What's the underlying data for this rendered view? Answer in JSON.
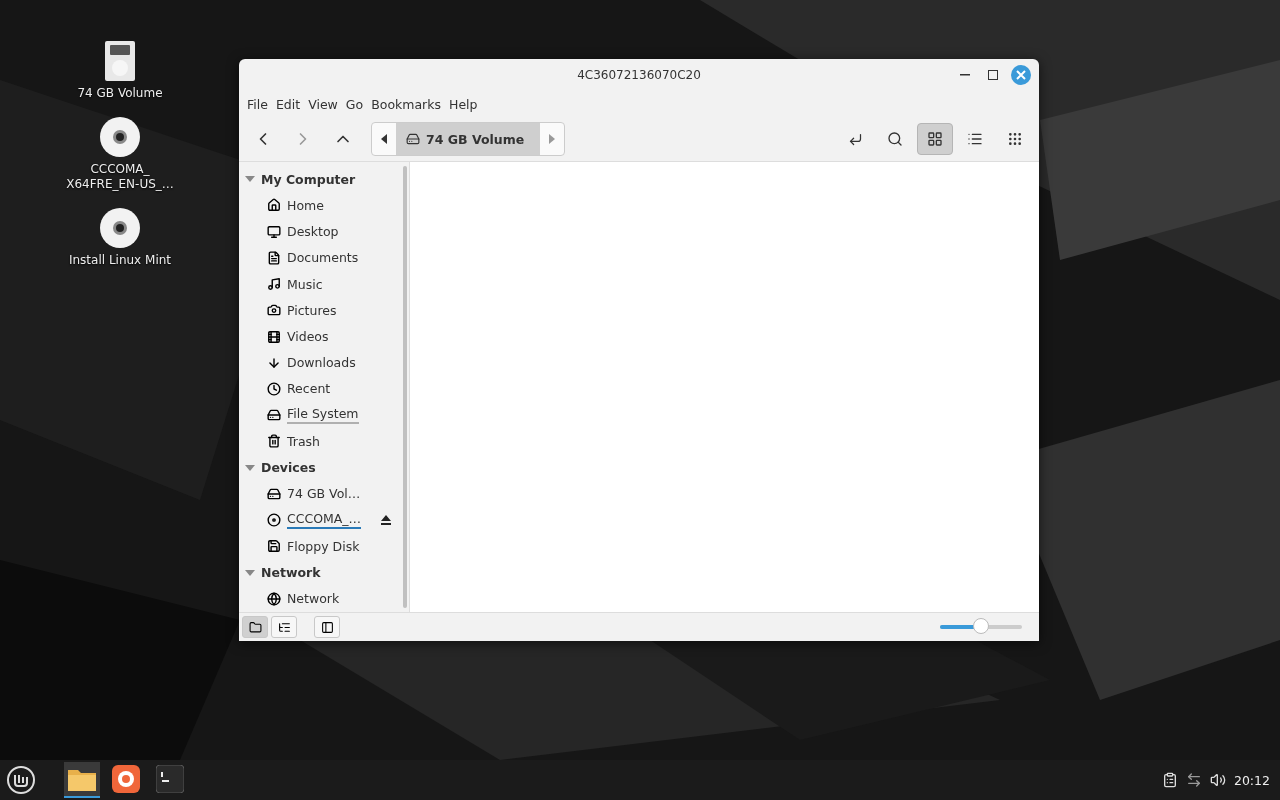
{
  "desktop_icons": [
    {
      "label": "74 GB Volume",
      "kind": "drive"
    },
    {
      "label": "CCCOMA_\nX64FRE_EN-US_…",
      "kind": "disc"
    },
    {
      "label": "Install Linux Mint",
      "kind": "disc"
    }
  ],
  "window": {
    "title": "4C36072136070C20",
    "menu": [
      "File",
      "Edit",
      "View",
      "Go",
      "Bookmarks",
      "Help"
    ],
    "path": {
      "label": "74 GB Volume"
    },
    "views": [
      {
        "kind": "icons",
        "selected": true
      },
      {
        "kind": "list",
        "selected": false
      },
      {
        "kind": "compact",
        "selected": false
      }
    ],
    "sidebar": [
      {
        "label": "My Computer",
        "expanded": true,
        "children": [
          {
            "label": "Home"
          },
          {
            "label": "Desktop"
          },
          {
            "label": "Documents"
          },
          {
            "label": "Music"
          },
          {
            "label": "Pictures"
          },
          {
            "label": "Videos"
          },
          {
            "label": "Downloads"
          },
          {
            "label": "Recent"
          },
          {
            "label": "File System",
            "level": 0
          },
          {
            "label": "Trash"
          }
        ]
      },
      {
        "label": "Devices",
        "expanded": true,
        "children": [
          {
            "label": "74 GB Vol…"
          },
          {
            "label": "CCCOMA_…",
            "level": 1,
            "ejectable": true
          },
          {
            "label": "Floppy Disk"
          }
        ]
      },
      {
        "label": "Network",
        "expanded": true,
        "children": [
          {
            "label": "Network"
          }
        ]
      }
    ],
    "pane_modes": [
      {
        "kind": "places",
        "selected": true
      },
      {
        "kind": "tree",
        "selected": false
      }
    ],
    "zoom": {
      "level": 0.5
    }
  },
  "taskbar": {
    "apps": [
      {
        "kind": "files",
        "active": true
      },
      {
        "kind": "browser",
        "active": false
      },
      {
        "kind": "terminal",
        "active": false
      }
    ],
    "clock": "20:12"
  }
}
